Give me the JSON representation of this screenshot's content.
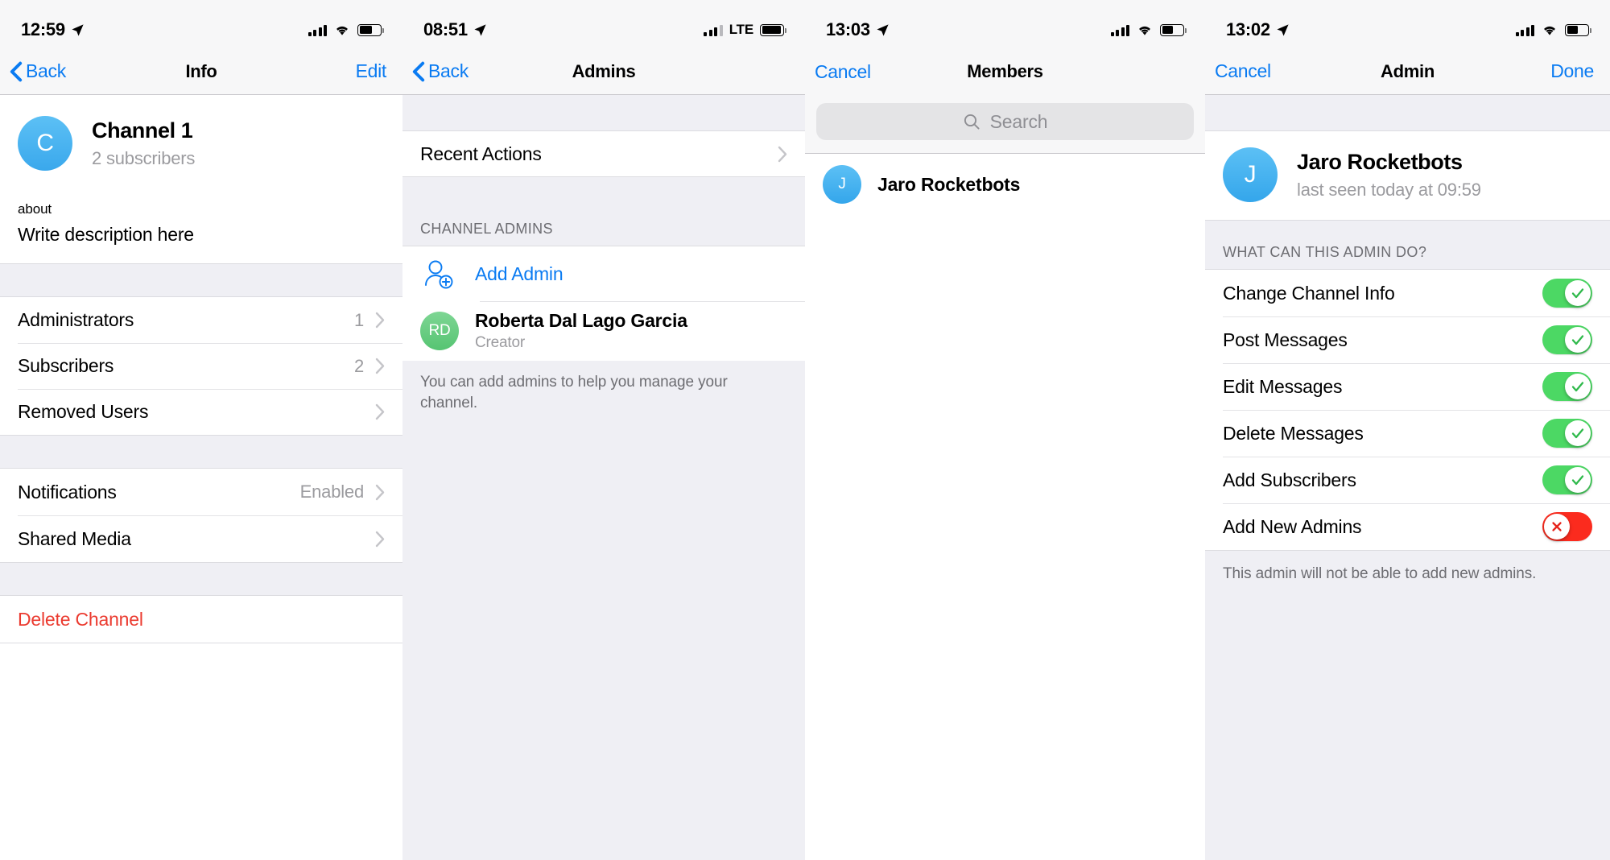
{
  "panels": [
    {
      "status": {
        "time": "12:59",
        "carrier": "",
        "network": "wifi"
      },
      "nav": {
        "back": "Back",
        "title": "Info",
        "right": "Edit"
      },
      "profile": {
        "initial": "C",
        "name": "Channel 1",
        "subtitle": "2 subscribers"
      },
      "about": {
        "label": "about",
        "text": "Write description here"
      },
      "rows": [
        {
          "label": "Administrators",
          "value": "1"
        },
        {
          "label": "Subscribers",
          "value": "2"
        },
        {
          "label": "Removed Users",
          "value": ""
        }
      ],
      "rows2": [
        {
          "label": "Notifications",
          "value": "Enabled"
        },
        {
          "label": "Shared Media",
          "value": ""
        }
      ],
      "destructive": "Delete Channel"
    },
    {
      "status": {
        "time": "08:51",
        "carrier": "LTE",
        "network": "lte"
      },
      "nav": {
        "back": "Back",
        "title": "Admins",
        "right": ""
      },
      "recent_actions": "Recent Actions",
      "section_header": "CHANNEL ADMINS",
      "add_admin": "Add Admin",
      "admin": {
        "initials": "RD",
        "name": "Roberta Dal Lago Garcia",
        "role": "Creator"
      },
      "footnote": "You can add admins to help you manage your channel."
    },
    {
      "status": {
        "time": "13:03",
        "carrier": "",
        "network": "wifi"
      },
      "nav": {
        "back": "Cancel",
        "title": "Members",
        "right": ""
      },
      "search_placeholder": "Search",
      "members": [
        {
          "initial": "J",
          "name": "Jaro Rocketbots"
        }
      ]
    },
    {
      "status": {
        "time": "13:02",
        "carrier": "",
        "network": "wifi"
      },
      "nav": {
        "back": "Cancel",
        "title": "Admin",
        "right": "Done"
      },
      "profile": {
        "initial": "J",
        "name": "Jaro Rocketbots",
        "subtitle": "last seen today at 09:59"
      },
      "section_header": "WHAT CAN THIS ADMIN DO?",
      "permissions": [
        {
          "label": "Change Channel Info",
          "enabled": true
        },
        {
          "label": "Post Messages",
          "enabled": true
        },
        {
          "label": "Edit Messages",
          "enabled": true
        },
        {
          "label": "Delete Messages",
          "enabled": true
        },
        {
          "label": "Add Subscribers",
          "enabled": true
        },
        {
          "label": "Add New Admins",
          "enabled": false
        }
      ],
      "footnote": "This admin will not be able to add new admins."
    }
  ],
  "colors": {
    "accent_blue": "#0a7bf2",
    "destructive_red": "#eb3b30",
    "toggle_on_green": "#4cd864",
    "toggle_off_red": "#fb2b1e",
    "group_background": "#efeff4"
  }
}
